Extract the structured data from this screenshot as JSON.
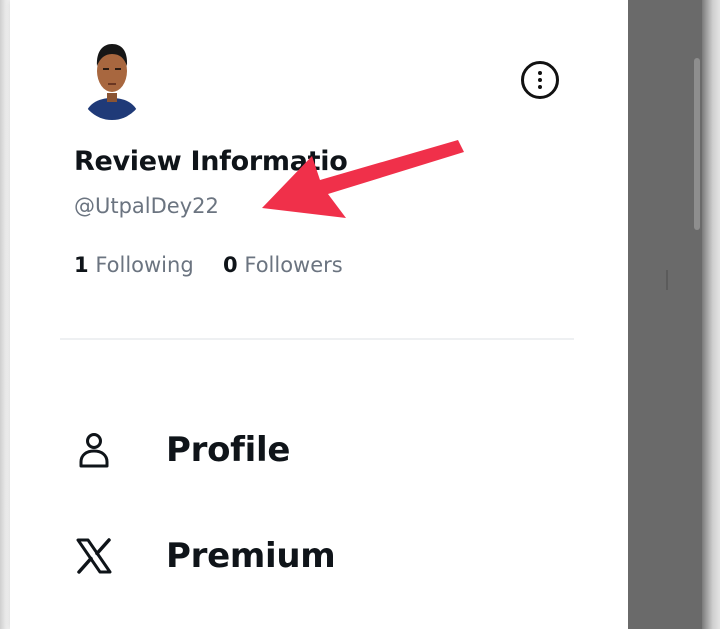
{
  "account": {
    "display_name": "Review Informatio",
    "handle": "@UtpalDey22",
    "following_count": "1",
    "following_label": "Following",
    "followers_count": "0",
    "followers_label": "Followers"
  },
  "header": {
    "more_icon": "more-options-icon"
  },
  "nav": {
    "items": [
      {
        "icon": "person-icon",
        "label": "Profile"
      },
      {
        "icon": "x-logo-icon",
        "label": "Premium"
      }
    ]
  },
  "colors": {
    "text_primary": "#0f1419",
    "text_secondary": "#6b7480",
    "annotation_arrow": "#f0304a",
    "scrim": "#6a6a6a"
  }
}
